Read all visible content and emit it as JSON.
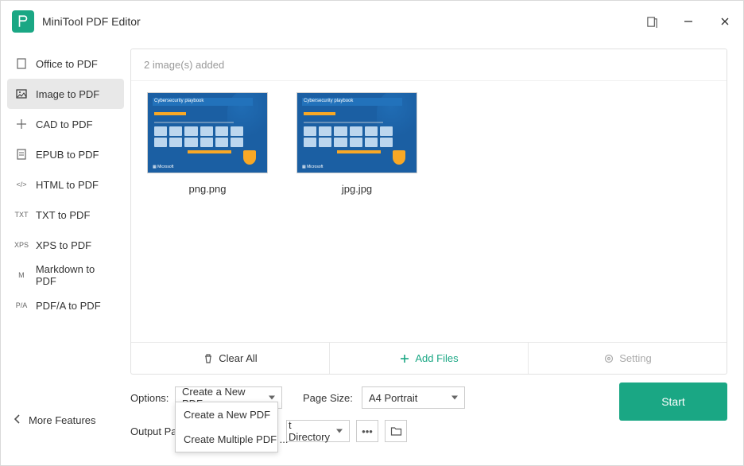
{
  "app": {
    "title": "MiniTool PDF Editor"
  },
  "sidebar": {
    "items": [
      {
        "label": "Office to PDF",
        "code": "O"
      },
      {
        "label": "Image to PDF",
        "code": "IMG"
      },
      {
        "label": "CAD to PDF",
        "code": "CAD"
      },
      {
        "label": "EPUB to PDF",
        "code": "E"
      },
      {
        "label": "HTML to PDF",
        "code": "</>"
      },
      {
        "label": "TXT to PDF",
        "code": "TXT"
      },
      {
        "label": "XPS to PDF",
        "code": "XPS"
      },
      {
        "label": "Markdown to PDF",
        "code": "M"
      },
      {
        "label": "PDF/A to PDF",
        "code": "P/A"
      }
    ],
    "more": "More Features"
  },
  "panel": {
    "count_text": "2 image(s) added",
    "thumbs": [
      {
        "name": "png.png",
        "thumb_title": "Cybersecurity playbook"
      },
      {
        "name": "jpg.jpg",
        "thumb_title": "Cybersecurity playbook"
      }
    ],
    "footer": {
      "clear": "Clear All",
      "add": "Add Files",
      "setting": "Setting"
    }
  },
  "controls": {
    "options_label": "Options:",
    "options_value": "Create a New PDF",
    "options_menu": [
      "Create a New PDF",
      "Create Multiple PDF ..."
    ],
    "pagesize_label": "Page Size:",
    "pagesize_value": "A4 Portrait",
    "output_label_partial": "Output Pat",
    "output_value_partial": "t Directory",
    "start": "Start"
  }
}
